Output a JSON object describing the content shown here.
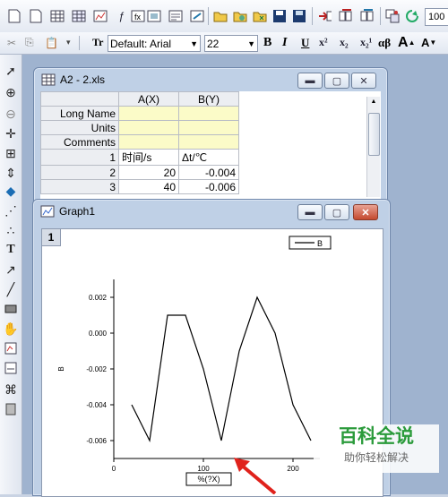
{
  "toolbar": {
    "font_name": "Default: Arial",
    "font_size": "22",
    "bold": "B",
    "italic": "I",
    "underline": "U",
    "sup": "x²",
    "sub": "x₂",
    "supsub": "x₂¹",
    "greek": "αβ",
    "grow": "A",
    "shrink": "A",
    "right_field": "100"
  },
  "worksheet": {
    "title": "A2 - 2.xls",
    "columns": [
      "A(X)",
      "B(Y)"
    ],
    "row_headers": [
      "Long Name",
      "Units",
      "Comments",
      "1",
      "2",
      "3"
    ],
    "rows": [
      [
        "",
        ""
      ],
      [
        "",
        ""
      ],
      [
        "",
        ""
      ],
      [
        "时间/s",
        "Δt/℃"
      ],
      [
        "20",
        "-0.004"
      ],
      [
        "40",
        "-0.006"
      ]
    ]
  },
  "graph": {
    "title": "Graph1",
    "layer": "1",
    "legend": "B",
    "x_axis_label": "%(?X)",
    "y_axis_label": "B"
  },
  "chart_data": {
    "type": "line",
    "title": "",
    "xlabel": "%(?X)",
    "ylabel": "B",
    "xlim": [
      0,
      230
    ],
    "ylim": [
      -0.007,
      0.003
    ],
    "xticks": [
      0,
      100,
      200
    ],
    "yticks": [
      0.002,
      0.0,
      -0.002,
      -0.004,
      -0.006
    ],
    "ytick_labels": [
      "0.002",
      "0.000",
      "-0.002",
      "-0.004",
      "-0.006"
    ],
    "series": [
      {
        "name": "B",
        "x": [
          20,
          40,
          60,
          80,
          100,
          120,
          140,
          160,
          180,
          200,
          220
        ],
        "y": [
          -0.004,
          -0.006,
          0.001,
          0.001,
          -0.002,
          -0.006,
          -0.001,
          0.002,
          0.0,
          -0.004,
          -0.006
        ]
      }
    ],
    "legend": "top-right",
    "grid": false
  },
  "watermark": {
    "title": "百科全说",
    "subtitle": "助你轻松解决"
  },
  "colors": {
    "arrow": "#e0221c",
    "watermark": "#2b9b3b",
    "sheet_highlight": "#fbfbc8"
  }
}
